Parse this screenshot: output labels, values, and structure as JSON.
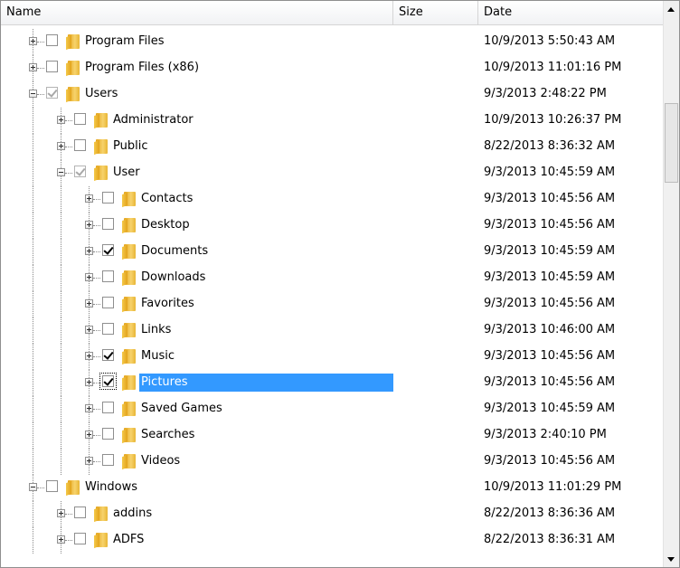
{
  "columns": {
    "name": "Name",
    "size": "Size",
    "date": "Date"
  },
  "rows": [
    {
      "name": "Program Files",
      "size": "",
      "date": "10/9/2013 5:50:43 AM",
      "checked": false,
      "grayed": false,
      "expanded": false,
      "selected": false
    },
    {
      "name": "Program Files (x86)",
      "size": "",
      "date": "10/9/2013 11:01:16 PM",
      "checked": false,
      "grayed": false,
      "expanded": false,
      "selected": false
    },
    {
      "name": "Users",
      "size": "",
      "date": "9/3/2013 2:48:22 PM",
      "checked": true,
      "grayed": true,
      "expanded": true,
      "selected": false
    },
    {
      "name": "Administrator",
      "size": "",
      "date": "10/9/2013 10:26:37 PM",
      "checked": false,
      "grayed": false,
      "expanded": false,
      "selected": false
    },
    {
      "name": "Public",
      "size": "",
      "date": "8/22/2013 8:36:32 AM",
      "checked": false,
      "grayed": false,
      "expanded": false,
      "selected": false
    },
    {
      "name": "User",
      "size": "",
      "date": "9/3/2013 10:45:59 AM",
      "checked": true,
      "grayed": true,
      "expanded": true,
      "selected": false
    },
    {
      "name": "Contacts",
      "size": "",
      "date": "9/3/2013 10:45:56 AM",
      "checked": false,
      "grayed": false,
      "expanded": false,
      "selected": false
    },
    {
      "name": "Desktop",
      "size": "",
      "date": "9/3/2013 10:45:56 AM",
      "checked": false,
      "grayed": false,
      "expanded": false,
      "selected": false
    },
    {
      "name": "Documents",
      "size": "",
      "date": "9/3/2013 10:45:59 AM",
      "checked": true,
      "grayed": false,
      "expanded": false,
      "selected": false
    },
    {
      "name": "Downloads",
      "size": "",
      "date": "9/3/2013 10:45:59 AM",
      "checked": false,
      "grayed": false,
      "expanded": false,
      "selected": false
    },
    {
      "name": "Favorites",
      "size": "",
      "date": "9/3/2013 10:45:56 AM",
      "checked": false,
      "grayed": false,
      "expanded": false,
      "selected": false
    },
    {
      "name": "Links",
      "size": "",
      "date": "9/3/2013 10:46:00 AM",
      "checked": false,
      "grayed": false,
      "expanded": false,
      "selected": false
    },
    {
      "name": "Music",
      "size": "",
      "date": "9/3/2013 10:45:56 AM",
      "checked": true,
      "grayed": false,
      "expanded": false,
      "selected": false
    },
    {
      "name": "Pictures",
      "size": "",
      "date": "9/3/2013 10:45:56 AM",
      "checked": true,
      "grayed": false,
      "expanded": false,
      "selected": true
    },
    {
      "name": "Saved Games",
      "size": "",
      "date": "9/3/2013 10:45:59 AM",
      "checked": false,
      "grayed": false,
      "expanded": false,
      "selected": false
    },
    {
      "name": "Searches",
      "size": "",
      "date": "9/3/2013 2:40:10 PM",
      "checked": false,
      "grayed": false,
      "expanded": false,
      "selected": false
    },
    {
      "name": "Videos",
      "size": "",
      "date": "9/3/2013 10:45:56 AM",
      "checked": false,
      "grayed": false,
      "expanded": false,
      "selected": false
    },
    {
      "name": "Windows",
      "size": "",
      "date": "10/9/2013 11:01:29 PM",
      "checked": false,
      "grayed": false,
      "expanded": true,
      "selected": false
    },
    {
      "name": "addins",
      "size": "",
      "date": "8/22/2013 8:36:36 AM",
      "checked": false,
      "grayed": false,
      "expanded": false,
      "selected": false
    },
    {
      "name": "ADFS",
      "size": "",
      "date": "8/22/2013 8:36:31 AM",
      "checked": false,
      "grayed": false,
      "expanded": false,
      "selected": false
    }
  ],
  "selection_color": "#3399ff"
}
